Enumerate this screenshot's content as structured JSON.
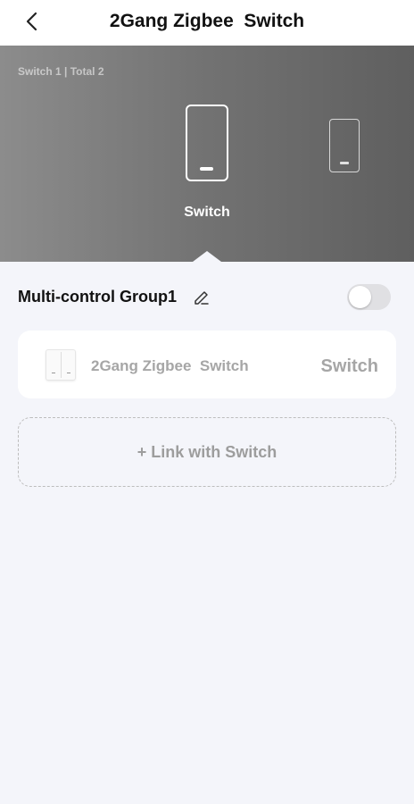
{
  "header": {
    "back_icon": "chevron-left-icon",
    "title": "2Gang Zigbee  Switch"
  },
  "banner": {
    "counter": "Switch 1 | Total 2",
    "selected_label": "Switch",
    "background_from": "#8c8c8c",
    "background_to": "#5f5f5f"
  },
  "group": {
    "title": "Multi-control Group1",
    "edit_icon": "pencil-icon",
    "enabled": false
  },
  "device": {
    "name": "2Gang Zigbee  Switch",
    "channel": "Switch"
  },
  "actions": {
    "link_label": "+ Link with Switch"
  },
  "colors": {
    "page_bg": "#f4f5fa",
    "muted_text": "#a6a6a6"
  }
}
